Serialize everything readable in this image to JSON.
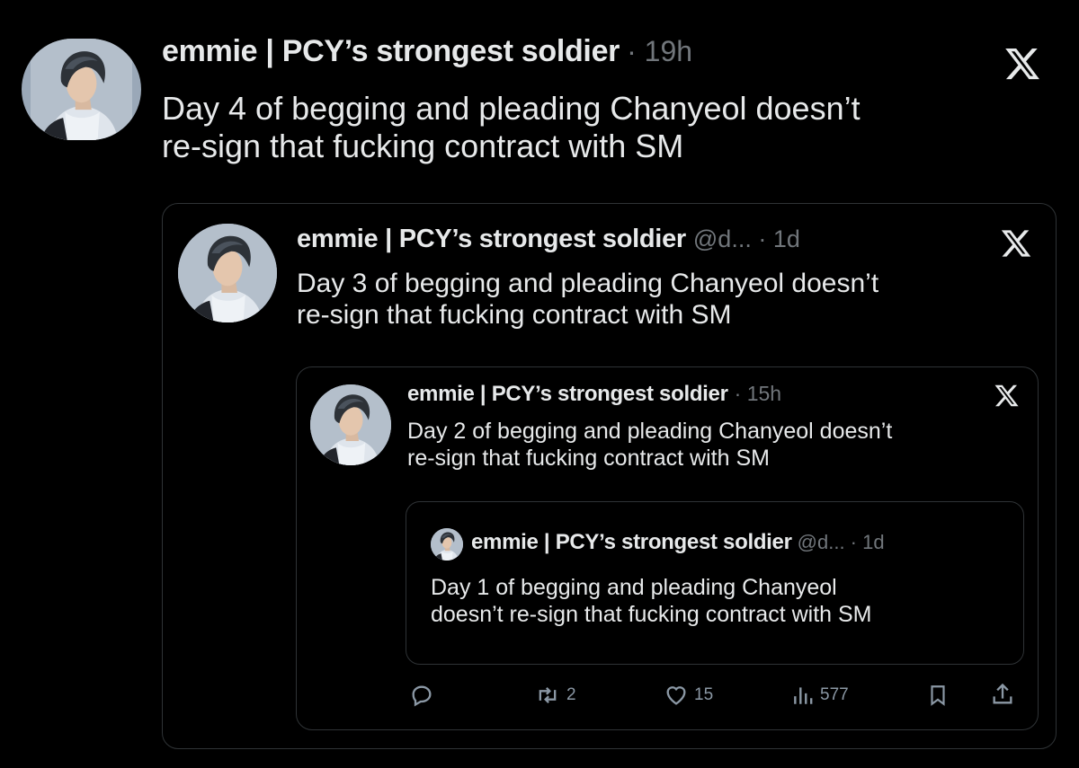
{
  "tweets": [
    {
      "name": "emmie | PCY’s strongest soldier",
      "meta": "· 19h",
      "text_line1": "Day 4 of begging and pleading Chanyeol doesn’t",
      "text_line2": "re-sign that fucking contract with SM"
    },
    {
      "name": "emmie | PCY’s strongest soldier",
      "meta": "@d... · 1d",
      "text_line1": "Day 3 of begging and pleading Chanyeol doesn’t",
      "text_line2": "re-sign that fucking contract with SM"
    },
    {
      "name": "emmie | PCY’s strongest soldier",
      "meta": "· 15h",
      "text_line1": "Day 2 of begging and pleading Chanyeol doesn’t",
      "text_line2": "re-sign that fucking contract with SM"
    },
    {
      "name": "emmie | PCY’s strongest soldier",
      "meta": "@d... · 1d",
      "text_line1": "Day 1 of begging and pleading Chanyeol",
      "text_line2": "doesn’t re-sign that fucking contract with SM"
    }
  ],
  "actions": {
    "reply_icon": "reply-icon",
    "retweet_count": "2",
    "like_count": "15",
    "views_count": "577",
    "bookmark_icon": "bookmark-icon",
    "share_icon": "share-icon"
  },
  "colors": {
    "background": "#000000",
    "text": "#e7e9ea",
    "muted": "#71767b",
    "border": "#2f3336"
  }
}
